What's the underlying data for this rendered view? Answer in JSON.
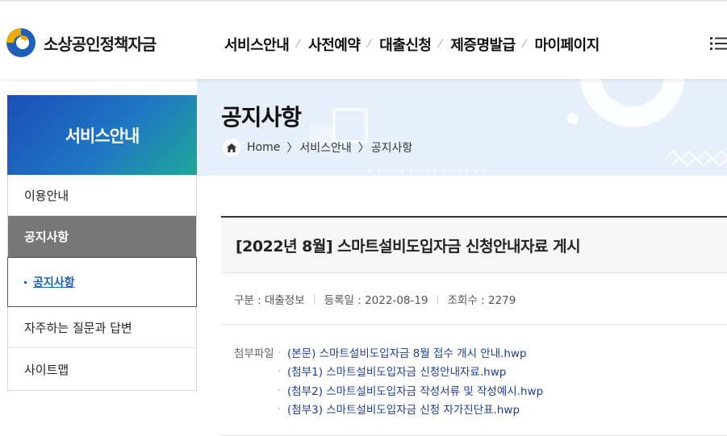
{
  "header": {
    "logo_text": "소상공인정책자금",
    "nav": [
      "서비스안내",
      "사전예약",
      "대출신청",
      "제증명발급",
      "마이페이지"
    ],
    "nav_separator": "⁄"
  },
  "visual": {
    "title": "공지사항",
    "breadcrumb": [
      "Home",
      "서비스안내",
      "공지사항"
    ],
    "breadcrumb_sep": "〉"
  },
  "lnb": {
    "title": "서비스안내",
    "items": [
      "이용안내",
      "공지사항",
      "공지사항",
      "자주하는 질문과 답변",
      "사이트맵"
    ]
  },
  "article": {
    "title": "[2022년 8월] 스마트설비도입자금 신청안내자료 게시",
    "meta": {
      "category_label": "구분 : 대출정보",
      "date_label": "등록일 : 2022-08-19",
      "views_label": "조회수 : 2279",
      "separator": "|"
    },
    "attachments_label": "첨부파일",
    "attachments": [
      "(본문) 스마트설비도입자금 8월 접수 개시 안내.hwp",
      "(첨부1) 스마트설비도입자금 신청안내자료.hwp",
      "(첨부2) 스마트설비도입자금 작성서류 및 작성예시.hwp",
      "(첨부3) 스마트설비도입자금 신청 자가진단표.hwp"
    ]
  },
  "colors": {
    "lnb_gradient_start": "#1a4fb8",
    "lnb_gradient_end": "#20a89a",
    "lnb_active_bg": "#777777",
    "link": "#1f3f8f",
    "banner_bg": "#e6effa"
  },
  "icons": [
    "logo-mark-icon",
    "menu-list-icon",
    "home-icon",
    "bullet-dot-icon"
  ]
}
